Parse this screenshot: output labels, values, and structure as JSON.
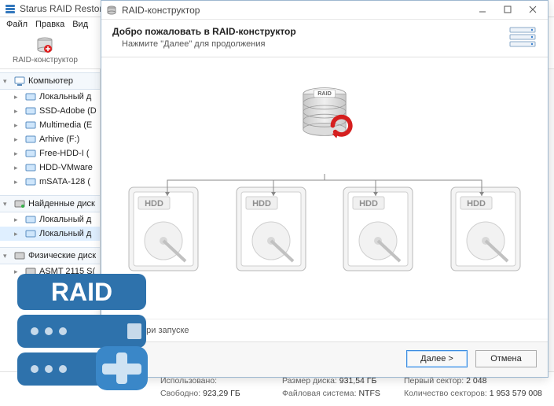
{
  "app": {
    "title": "Starus RAID Restore 1",
    "menu": [
      "Файл",
      "Правка",
      "Вид"
    ],
    "toolbar_label": "RAID-конструктор"
  },
  "tree": {
    "groups": [
      {
        "header": "Компьютер",
        "items": [
          "Локальный д",
          "SSD-Adobe (D",
          "Multimedia (E",
          "Arhive (F:)",
          "Free-HDD-I (",
          "HDD-VMware",
          "mSATA-128 ("
        ]
      },
      {
        "header": "Найденные диск",
        "items": [
          "Локальный д",
          "Локальный д"
        ]
      },
      {
        "header": "Физические диск",
        "items": [
          "ASMT 2115 S("
        ]
      }
    ]
  },
  "status": {
    "row1": {
      "used_label": "Использовано:",
      "used_val": "",
      "size_label": "Размер диска:",
      "size_val": "931,54 ГБ",
      "fsec_label": "Первый сектор:",
      "fsec_val": "2 048"
    },
    "row2": {
      "free_label": "Свободно:",
      "free_val": "923,29 ГБ",
      "fs_label": "Файловая система:",
      "fs_val": "NTFS",
      "nsec_label": "Количество секторов:",
      "nsec_val": "1 953 579 008"
    }
  },
  "dialog": {
    "title": "RAID-конструктор",
    "heading": "Добро пожаловать в RAID-конструктор",
    "subheading": "Нажмите \"Далее\" для продолжения",
    "raid_label": "RAID",
    "hdd_label": "HDD",
    "startup_cb": "тер при запуске",
    "next": "Далее >",
    "cancel": "Отмена"
  },
  "overlay": {
    "label": "RAID"
  }
}
